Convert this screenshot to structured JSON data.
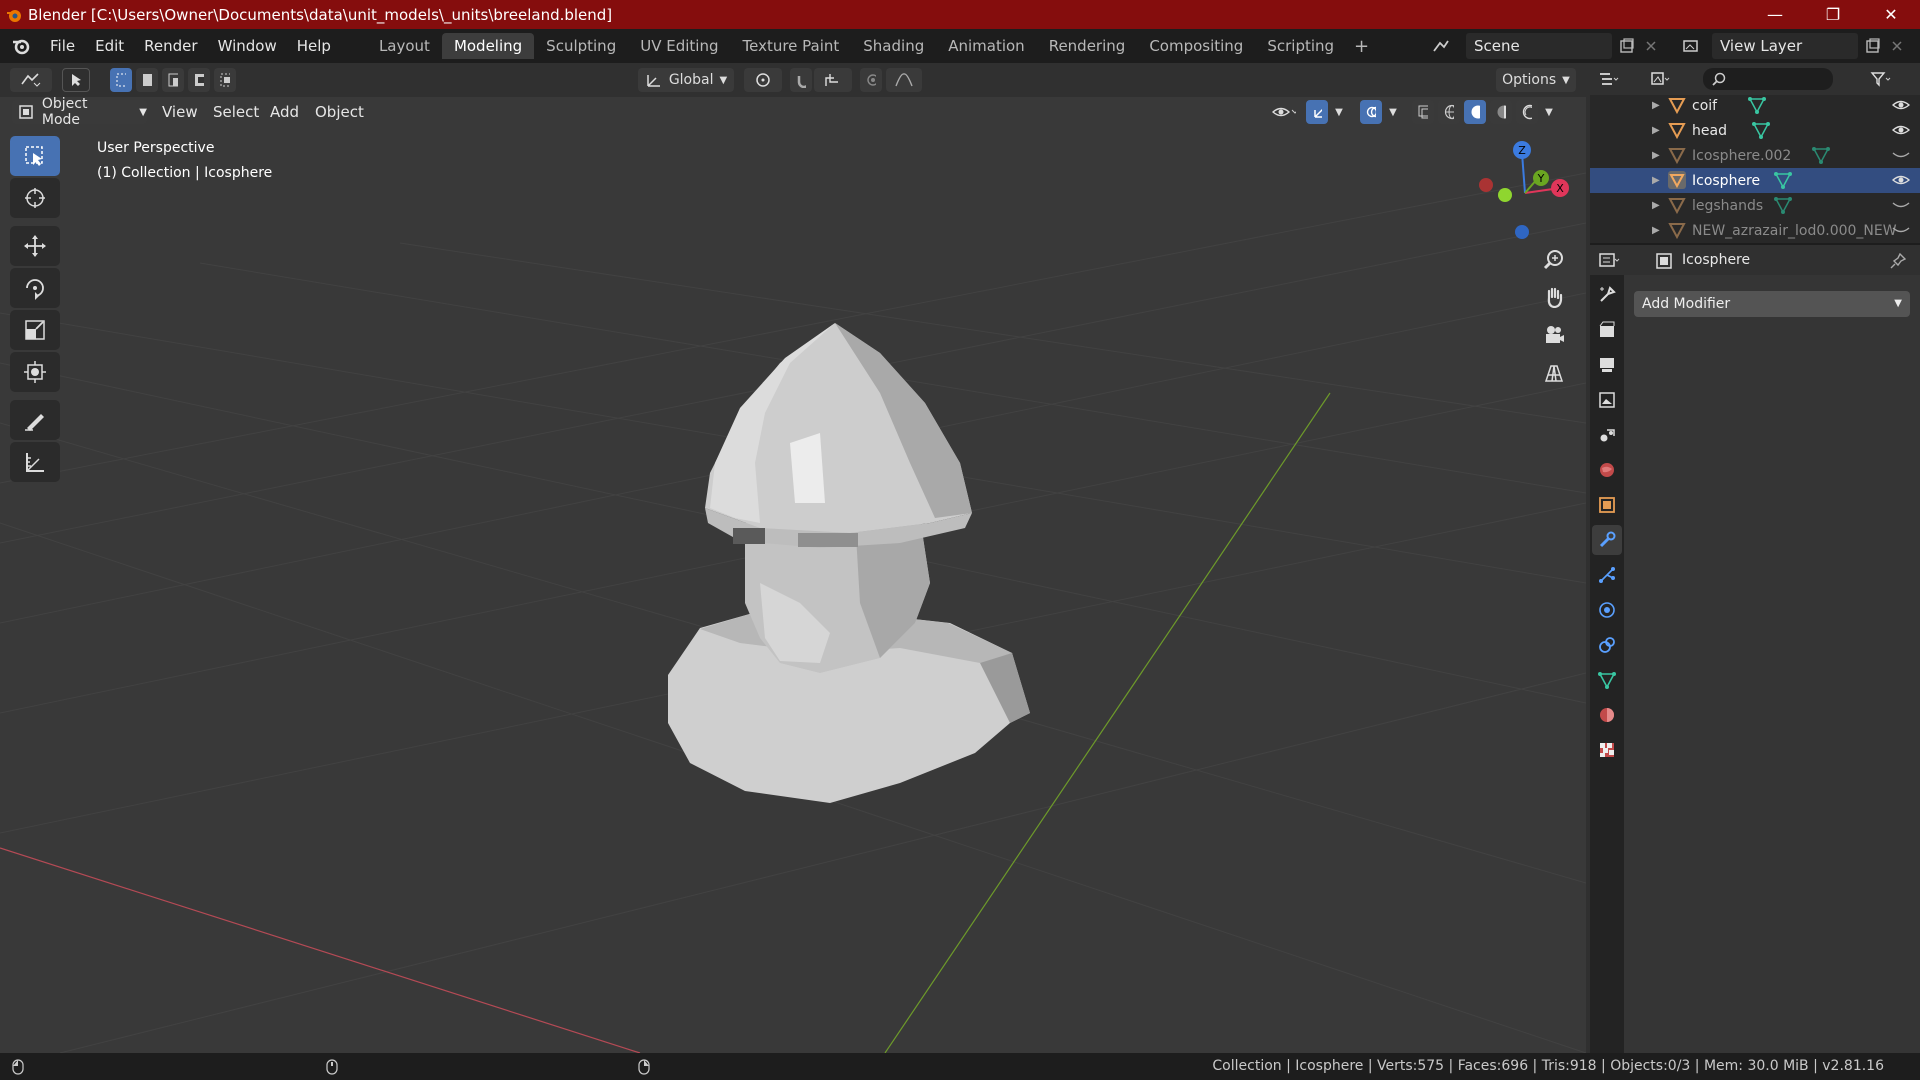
{
  "window": {
    "title": "Blender [C:\\Users\\Owner\\Documents\\data\\unit_models\\_units\\breeland.blend]",
    "controls": [
      "—",
      "❐",
      "✕"
    ]
  },
  "menu": {
    "items": [
      "File",
      "Edit",
      "Render",
      "Window",
      "Help"
    ]
  },
  "workspaces": {
    "tabs": [
      "Layout",
      "Modeling",
      "Sculpting",
      "UV Editing",
      "Texture Paint",
      "Shading",
      "Animation",
      "Rendering",
      "Compositing",
      "Scripting"
    ],
    "active": "Modeling",
    "add": "+"
  },
  "scene": {
    "name": "Scene"
  },
  "view_layer": {
    "name": "View Layer"
  },
  "viewport": {
    "orientation": "Global",
    "options_label": "Options",
    "mode": "Object Mode",
    "menus": [
      "View",
      "Select",
      "Add",
      "Object"
    ],
    "info_line1": "User Perspective",
    "info_line2": "(1) Collection | Icosphere",
    "gizmo": {
      "z": "Z",
      "y": "Y",
      "x": "X"
    }
  },
  "outliner": {
    "rows": [
      {
        "name": "coif",
        "visible": true,
        "dim": false
      },
      {
        "name": "head",
        "visible": true,
        "dim": false
      },
      {
        "name": "Icosphere.002",
        "visible": false,
        "dim": true
      },
      {
        "name": "Icosphere",
        "visible": true,
        "dim": false,
        "selected": true
      },
      {
        "name": "legshands",
        "visible": false,
        "dim": true
      },
      {
        "name": "NEW_azrazair_lod0.000_NEW",
        "visible": false,
        "dim": true
      }
    ]
  },
  "properties": {
    "object_name": "Icosphere",
    "add_modifier": "Add Modifier"
  },
  "status": {
    "stats": "Collection | Icosphere | Verts:575 | Faces:696 | Tris:918 | Objects:0/3 | Mem: 30.0 MiB | v2.81.16"
  },
  "colors": {
    "titlebar": "#850d0d",
    "accent": "#4772b3",
    "mesh_icon": "#39c6a2",
    "object_icon": "#e59c53"
  }
}
